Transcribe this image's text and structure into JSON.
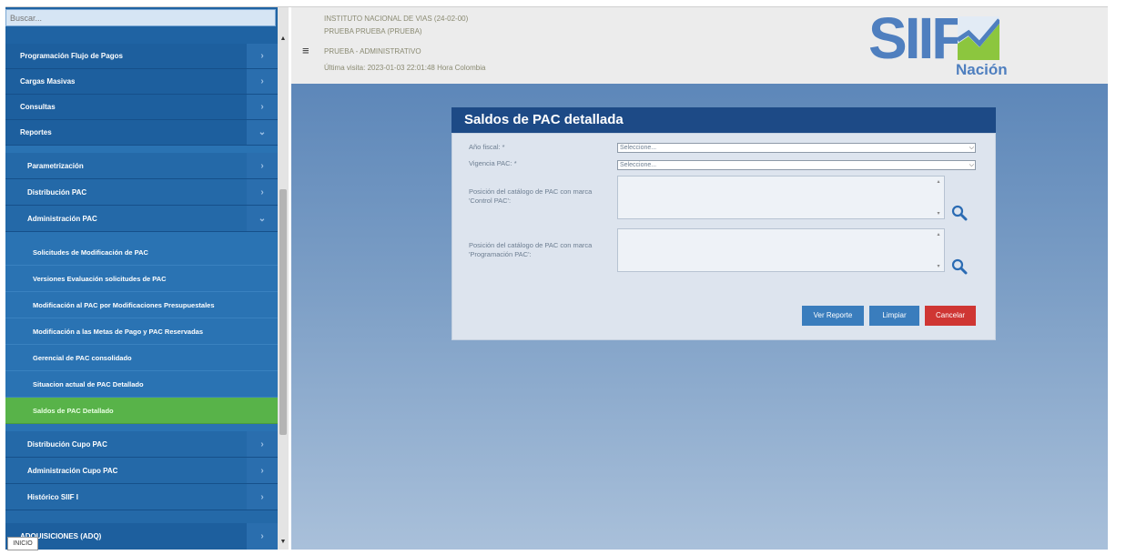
{
  "sidebar": {
    "search_placeholder": "Buscar...",
    "top_items": [
      {
        "label": "Programación Flujo de Pagos"
      },
      {
        "label": "Cargas Masivas"
      },
      {
        "label": "Consultas"
      },
      {
        "label": "Reportes"
      }
    ],
    "sub_items": [
      {
        "label": "Parametrización"
      },
      {
        "label": "Distribución PAC"
      },
      {
        "label": "Administración PAC"
      }
    ],
    "leaf_items": [
      {
        "label": "Solicitudes de Modificación de PAC"
      },
      {
        "label": "Versiones Evaluación solicitudes de PAC"
      },
      {
        "label": "Modificación al PAC por Modificaciones Presupuestales"
      },
      {
        "label": "Modificación a las Metas de Pago y PAC Reservadas"
      },
      {
        "label": "Gerencial de PAC consolidado"
      },
      {
        "label": "Situacion actual de PAC Detallado"
      },
      {
        "label": "Saldos de PAC Detallado"
      }
    ],
    "bottom_sub_items": [
      {
        "label": "Distribución Cupo PAC"
      },
      {
        "label": "Administración Cupo PAC"
      },
      {
        "label": "Histórico SIIF I"
      }
    ],
    "last_item": {
      "label": "ADQUISICIONES (ADQ)"
    },
    "inicio_badge": "INICIO",
    "active_color": "#58b349"
  },
  "header": {
    "line1": "INSTITUTO NACIONAL DE VIAS (24-02-00)",
    "line2": "PRUEBA PRUEBA (PRUEBA)",
    "line3": "PRUEBA - ADMINISTRATIVO",
    "line4": "Última visita: 2023-01-03 22:01:48 Hora Colombia",
    "logo_text": "SIIF",
    "logo_sub": "Nación"
  },
  "panel": {
    "title": "Saldos de PAC detallada",
    "fields": {
      "anio_fiscal_label": "Año fiscal: *",
      "anio_fiscal_value": "Seleccione...",
      "vigencia_label": "Vigencia PAC: *",
      "vigencia_value": "Seleccione...",
      "control_label": "Posición del catálogo de PAC con marca 'Control PAC':",
      "programacion_label": "Posición del catálogo de PAC con marca 'Programación PAC':"
    },
    "buttons": {
      "ver_reporte": "Ver Reporte",
      "limpiar": "Limpiar",
      "cancelar": "Cancelar"
    }
  }
}
